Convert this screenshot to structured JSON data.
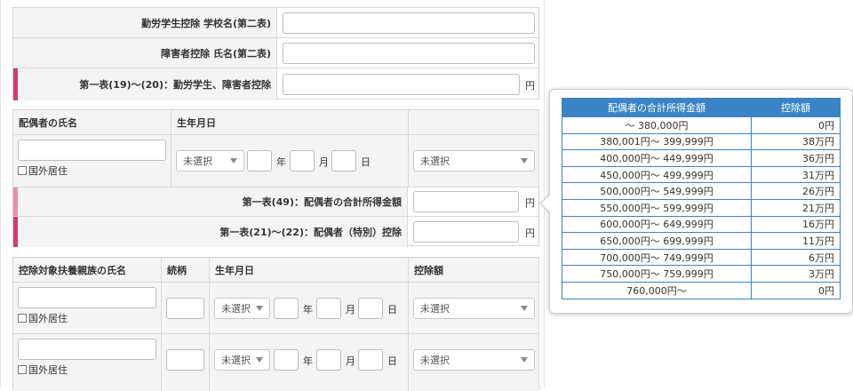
{
  "section1": {
    "school_label": "勤労学生控除 学校名(第二表)",
    "disabled_label": "障害者控除 氏名(第二表)",
    "total_label": "第一表(19)〜(20)：勤労学生、障害者控除",
    "unit": "円"
  },
  "spouse": {
    "header_name": "配偶者の氏名",
    "header_birth": "生年月日",
    "foreign_label": "国外居住",
    "select_default": "未選択",
    "year_label": "年",
    "month_label": "月",
    "day_label": "日",
    "income_label": "第一表(49)：配偶者の合計所得金額",
    "deduction_label": "第一表(21)〜(22)：配偶者（特別）控除",
    "unit": "円"
  },
  "dependents": {
    "header_name": "控除対象扶養親族の氏名",
    "header_relation": "続柄",
    "header_birth": "生年月日",
    "header_amount": "控除額",
    "foreign_label": "国外居住",
    "select_default": "未選択",
    "year_label": "年",
    "month_label": "月",
    "day_label": "日"
  },
  "popup": {
    "col1_header": "配偶者の合計所得金額",
    "col2_header": "控除額",
    "rows": [
      {
        "range": "〜 380,000円",
        "amount": "0円"
      },
      {
        "range": "380,001円〜 399,999円",
        "amount": "38万円"
      },
      {
        "range": "400,000円〜 449,999円",
        "amount": "36万円"
      },
      {
        "range": "450,000円〜 499,999円",
        "amount": "31万円"
      },
      {
        "range": "500,000円〜 549,999円",
        "amount": "26万円"
      },
      {
        "range": "550,000円〜 599,999円",
        "amount": "21万円"
      },
      {
        "range": "600,000円〜 649,999円",
        "amount": "16万円"
      },
      {
        "range": "650,000円〜 699,999円",
        "amount": "11万円"
      },
      {
        "range": "700,000円〜 749,999円",
        "amount": "6万円"
      },
      {
        "range": "750,000円〜 759,999円",
        "amount": "3万円"
      },
      {
        "range": "760,000円〜",
        "amount": "0円"
      }
    ]
  },
  "colors": {
    "required_mark": "#d23a72",
    "optional_mark": "#ec8cae",
    "table_header": "#3a84c6"
  }
}
